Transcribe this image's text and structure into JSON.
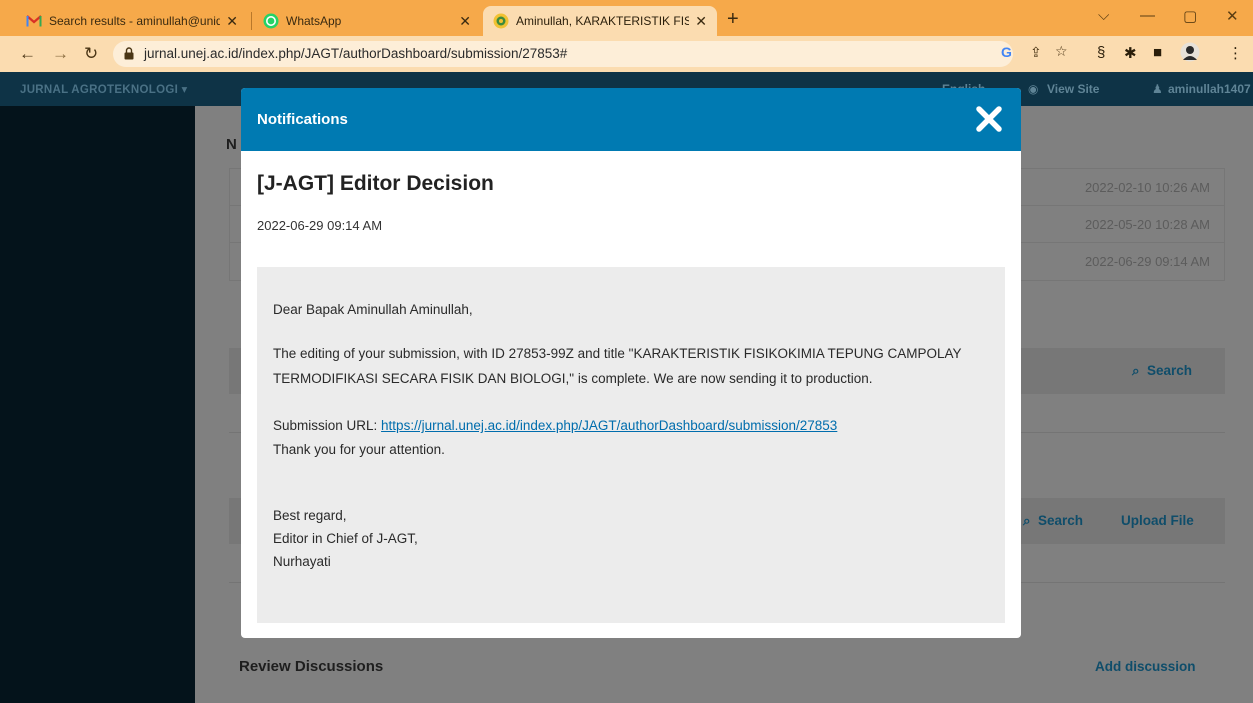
{
  "browser": {
    "tabs": [
      {
        "title": "Search results - aminullah@unid",
        "icon": "gmail-icon",
        "active": false
      },
      {
        "title": "WhatsApp",
        "icon": "whatsapp-icon",
        "active": false
      },
      {
        "title": "Aminullah, KARAKTERISTIK FISIK",
        "icon": "journal-favicon",
        "active": true
      }
    ],
    "new_tab_label": "+",
    "url": "jurnal.unej.ac.id/index.php/JAGT/authorDashboard/submission/27853#",
    "accent_color": "#f6a94a"
  },
  "site": {
    "brand": "JURNAL AGROTEKNOLOGI ▾",
    "language_label": "English",
    "view_site_label": "View Site",
    "username": "aminullah1407"
  },
  "background": {
    "heading": "N",
    "notification_timestamps": [
      "2022-02-10 10:26 AM",
      "2022-05-20 10:28 AM",
      "2022-06-29 09:14 AM"
    ],
    "search_label": "Search",
    "search_label_2": "Search",
    "upload_file_label": "Upload File",
    "review_discussions_title": "Review Discussions",
    "add_discussion_label": "Add discussion"
  },
  "modal": {
    "title": "Notifications",
    "header_color": "#007ab2",
    "subject": "[J-AGT] Editor Decision",
    "date": "2022-06-29 09:14 AM",
    "body": {
      "greeting": "Dear Bapak Aminullah Aminullah,",
      "paragraph_line1": "The editing of your submission, with ID 27853-99Z and title \"KARAKTERISTIK FISIKOKIMIA TEPUNG CAMPOLAY",
      "paragraph_line2": "TERMODIFIKASI SECARA FISIK DAN BIOLOGI,\" is complete. We are now sending it to production.",
      "url_prefix": "Submission URL: ",
      "url": "https://jurnal.unej.ac.id/index.php/JAGT/authorDashboard/submission/27853",
      "thanks": "Thank you for your attention.",
      "closing": "Best regard,",
      "signature_role": "Editor in Chief of J-AGT,",
      "signature_name": "Nurhayati"
    }
  }
}
